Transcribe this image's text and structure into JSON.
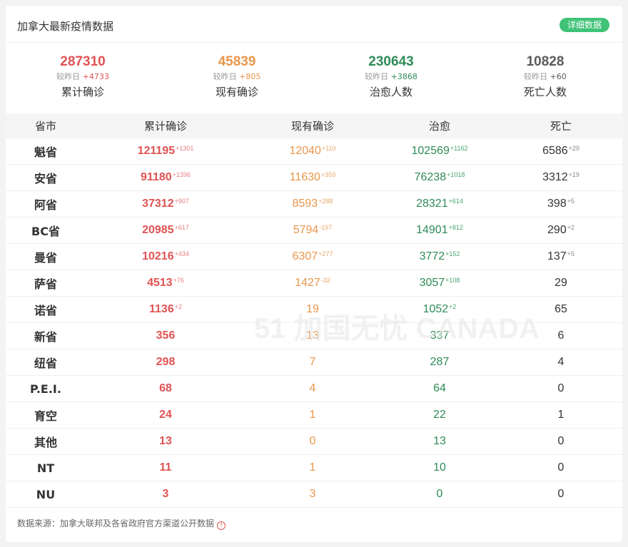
{
  "header": {
    "title": "加拿大最新疫情数据",
    "detail_button": "详细数据"
  },
  "stats": [
    {
      "value": "287310",
      "delta_label": "较昨日",
      "delta": "+4733",
      "label": "累计确诊",
      "color": "#e05353"
    },
    {
      "value": "45839",
      "delta_label": "较昨日",
      "delta": "+805",
      "label": "现有确诊",
      "color": "#e8964a"
    },
    {
      "value": "230643",
      "delta_label": "较昨日",
      "delta": "+3868",
      "label": "治愈人数",
      "color": "#2e8b57"
    },
    {
      "value": "10828",
      "delta_label": "较昨日",
      "delta": "+60",
      "label": "死亡人数",
      "color": "#5a5a5a"
    }
  ],
  "table": {
    "columns": [
      "省市",
      "累计确诊",
      "现有确诊",
      "治愈",
      "死亡"
    ],
    "rows": [
      {
        "prov": "魁省",
        "total": "121195",
        "total_d": "+1301",
        "cur": "12040",
        "cur_d": "+110",
        "heal": "102569",
        "heal_d": "+1162",
        "death": "6586",
        "death_d": "+29"
      },
      {
        "prov": "安省",
        "total": "91180",
        "total_d": "+1396",
        "cur": "11630",
        "cur_d": "+359",
        "heal": "76238",
        "heal_d": "+1018",
        "death": "3312",
        "death_d": "+19"
      },
      {
        "prov": "阿省",
        "total": "37312",
        "total_d": "+907",
        "cur": "8593",
        "cur_d": "+288",
        "heal": "28321",
        "heal_d": "+614",
        "death": "398",
        "death_d": "+5"
      },
      {
        "prov": "BC省",
        "total": "20985",
        "total_d": "+617",
        "cur": "5794",
        "cur_d": "-197",
        "heal": "14901",
        "heal_d": "+812",
        "death": "290",
        "death_d": "+2"
      },
      {
        "prov": "曼省",
        "total": "10216",
        "total_d": "+434",
        "cur": "6307",
        "cur_d": "+277",
        "heal": "3772",
        "heal_d": "+152",
        "death": "137",
        "death_d": "+5"
      },
      {
        "prov": "萨省",
        "total": "4513",
        "total_d": "+76",
        "cur": "1427",
        "cur_d": "-32",
        "heal": "3057",
        "heal_d": "+108",
        "death": "29",
        "death_d": ""
      },
      {
        "prov": "诺省",
        "total": "1136",
        "total_d": "+2",
        "cur": "19",
        "cur_d": "",
        "heal": "1052",
        "heal_d": "+2",
        "death": "65",
        "death_d": ""
      },
      {
        "prov": "新省",
        "total": "356",
        "total_d": "",
        "cur": "13",
        "cur_d": "",
        "heal": "337",
        "heal_d": "",
        "death": "6",
        "death_d": ""
      },
      {
        "prov": "纽省",
        "total": "298",
        "total_d": "",
        "cur": "7",
        "cur_d": "",
        "heal": "287",
        "heal_d": "",
        "death": "4",
        "death_d": ""
      },
      {
        "prov": "P.E.I.",
        "total": "68",
        "total_d": "",
        "cur": "4",
        "cur_d": "",
        "heal": "64",
        "heal_d": "",
        "death": "0",
        "death_d": ""
      },
      {
        "prov": "育空",
        "total": "24",
        "total_d": "",
        "cur": "1",
        "cur_d": "",
        "heal": "22",
        "heal_d": "",
        "death": "1",
        "death_d": ""
      },
      {
        "prov": "其他",
        "total": "13",
        "total_d": "",
        "cur": "0",
        "cur_d": "",
        "heal": "13",
        "heal_d": "",
        "death": "0",
        "death_d": ""
      },
      {
        "prov": "NT",
        "total": "11",
        "total_d": "",
        "cur": "1",
        "cur_d": "",
        "heal": "10",
        "heal_d": "",
        "death": "0",
        "death_d": ""
      },
      {
        "prov": "NU",
        "total": "3",
        "total_d": "",
        "cur": "3",
        "cur_d": "",
        "heal": "0",
        "heal_d": "",
        "death": "0",
        "death_d": ""
      }
    ]
  },
  "footer": {
    "source": "数据来源：加拿大联邦及各省政府官方渠道公开数据",
    "info_icon": "info-icon"
  },
  "watermark": {
    "text": "51 加国无忧 CANADA"
  },
  "colors": {
    "total": "#e05353",
    "current": "#e8964a",
    "healed": "#2e8b57",
    "death": "#333333",
    "button": "#3fc378"
  }
}
